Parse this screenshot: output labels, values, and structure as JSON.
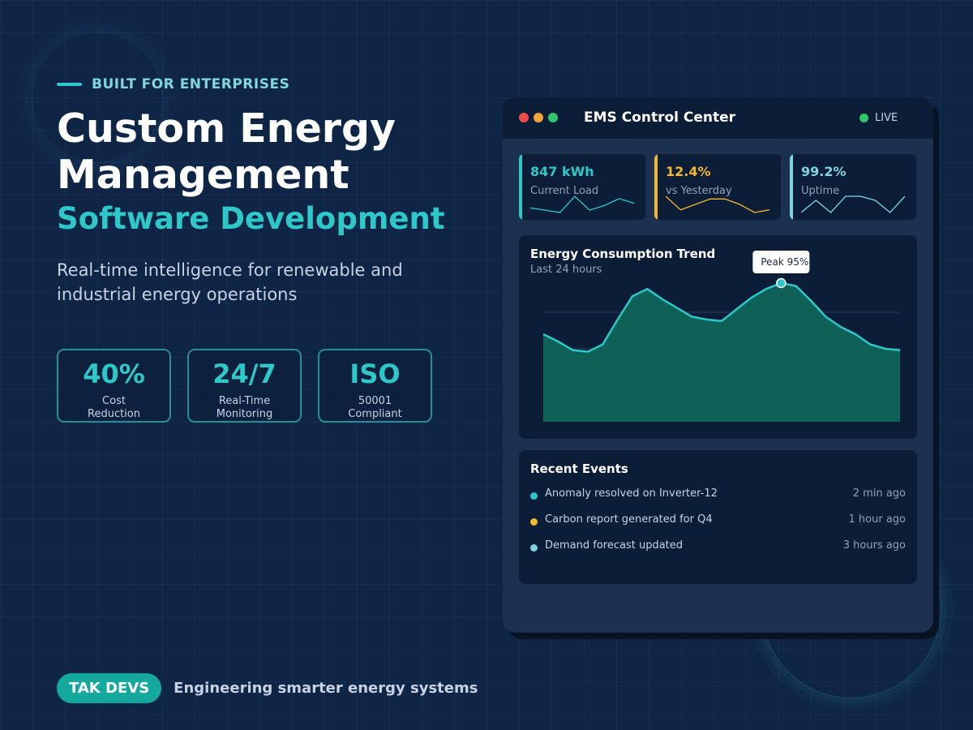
{
  "hero": {
    "eyebrow": "BUILT FOR ENTERPRISES",
    "title_line1": "Custom Energy",
    "title_line2": "Management",
    "subtitle": "Software Development",
    "description": "Real-time intelligence for renewable and industrial energy operations"
  },
  "stats": [
    {
      "value": "40%",
      "label": "Cost\nReduction"
    },
    {
      "value": "24/7",
      "label": "Real-Time\nMonitoring"
    },
    {
      "value": "ISO",
      "label": "50001\nCompliant"
    }
  ],
  "footer": {
    "brand": "TAK DEVS",
    "tagline": "Engineering smarter energy systems"
  },
  "dashboard": {
    "window_title": "EMS Control Center",
    "live_label": "LIVE",
    "kpis": [
      {
        "value": "847 kWh",
        "label": "Current Load",
        "color": "#2ec8c8",
        "sparkline": [
          4,
          3,
          2,
          9,
          3,
          5,
          8,
          6
        ]
      },
      {
        "value": "12.4%",
        "label": "vs Yesterday",
        "color": "#f4b92c",
        "sparkline": [
          8,
          3,
          5,
          7,
          7,
          5,
          2,
          3
        ]
      },
      {
        "value": "99.2%",
        "label": "Uptime",
        "color": "#7fd6dc",
        "sparkline": [
          4,
          7,
          4,
          8,
          8,
          7,
          4,
          8
        ]
      }
    ],
    "chart": {
      "title": "Energy Consumption Trend",
      "subtitle": "Last 24 hours",
      "tooltip": "Peak 95%"
    },
    "events": {
      "title": "Recent Events",
      "items": [
        {
          "text": "Anomaly resolved on Inverter-12",
          "time": "2 min ago",
          "color": "#2ec8c8"
        },
        {
          "text": "Carbon report generated for Q4",
          "time": "1 hour ago",
          "color": "#f4b92c"
        },
        {
          "text": "Demand forecast updated",
          "time": "3 hours ago",
          "color": "#7fd6dc"
        }
      ]
    }
  },
  "chart_data": {
    "type": "area",
    "title": "Energy Consumption Trend",
    "subtitle": "Last 24 hours",
    "x": [
      0,
      1,
      2,
      3,
      4,
      5,
      6,
      7,
      8,
      9,
      10,
      11,
      12,
      13,
      14,
      15,
      16,
      17,
      18,
      19,
      20,
      21,
      22,
      23,
      24
    ],
    "values": [
      60,
      55,
      49,
      48,
      53,
      70,
      86,
      91,
      84,
      78,
      72,
      70,
      69,
      77,
      85,
      91,
      95,
      93,
      83,
      72,
      65,
      60,
      53,
      50,
      49
    ],
    "ylim": [
      0,
      100
    ],
    "annotation": {
      "label": "Peak 95%",
      "x": 16,
      "y": 95
    },
    "grid": true,
    "color": "#2ec8c8",
    "fill": "#0e6157"
  }
}
